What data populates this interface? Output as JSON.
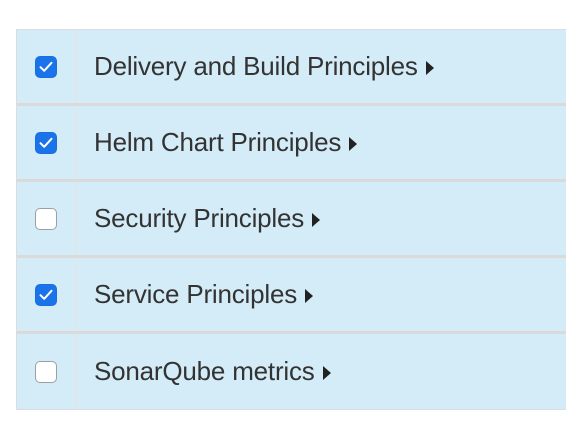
{
  "accent_color": "#1a73e8",
  "row_background": "#d4ecf7",
  "rows": [
    {
      "label": "Delivery and Build Principles",
      "checked": true,
      "expand_icon": "caret-right-icon"
    },
    {
      "label": "Helm Chart Principles",
      "checked": true,
      "expand_icon": "caret-right-icon"
    },
    {
      "label": "Security Principles",
      "checked": false,
      "expand_icon": "caret-right-icon"
    },
    {
      "label": "Service Principles",
      "checked": true,
      "expand_icon": "caret-right-icon"
    },
    {
      "label": "SonarQube metrics",
      "checked": false,
      "expand_icon": "caret-right-icon"
    }
  ]
}
